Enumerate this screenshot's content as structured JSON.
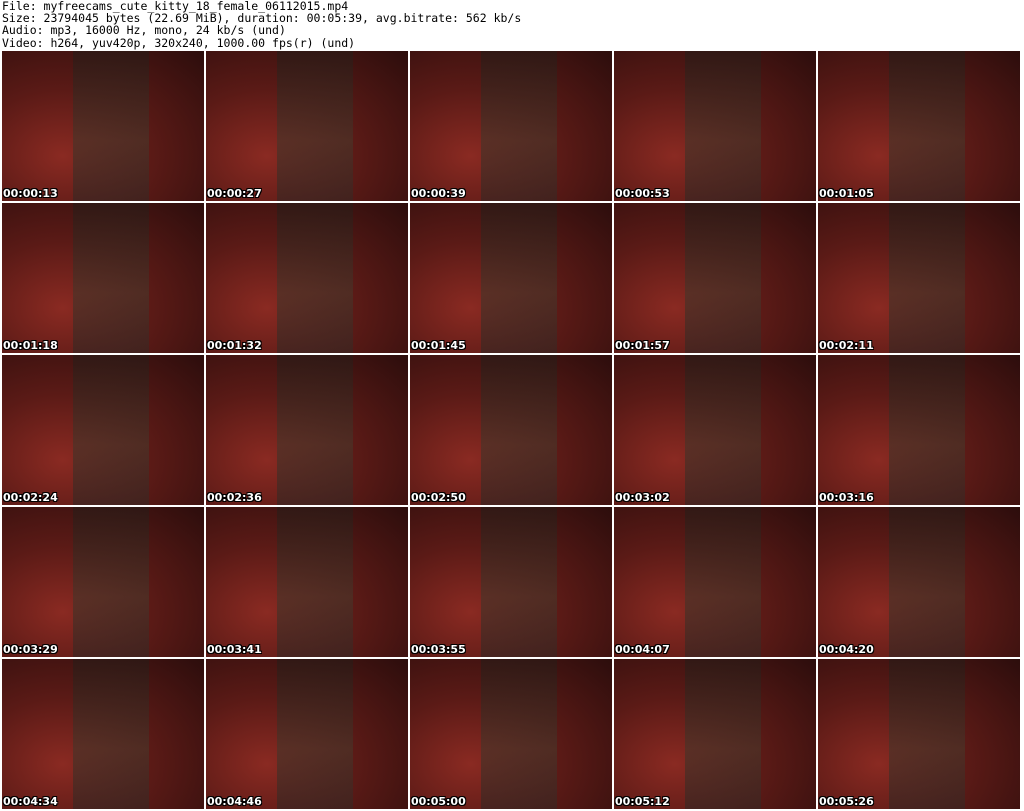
{
  "header": {
    "file": "File: myfreecams_cute_kitty_18_female_06112015.mp4",
    "size": "Size: 23794045 bytes (22.69 MiB), duration: 00:05:39, avg.bitrate: 562 kb/s",
    "audio": "Audio: mp3, 16000 Hz, mono, 24 kb/s (und)",
    "video": "Video: h264, yuv420p, 320x240, 1000.00 fps(r) (und)"
  },
  "thumbnails": [
    "00:00:13",
    "00:00:27",
    "00:00:39",
    "00:00:53",
    "00:01:05",
    "00:01:18",
    "00:01:32",
    "00:01:45",
    "00:01:57",
    "00:02:11",
    "00:02:24",
    "00:02:36",
    "00:02:50",
    "00:03:02",
    "00:03:16",
    "00:03:29",
    "00:03:41",
    "00:03:55",
    "00:04:07",
    "00:04:20",
    "00:04:34",
    "00:04:46",
    "00:05:00",
    "00:05:12",
    "00:05:26"
  ]
}
